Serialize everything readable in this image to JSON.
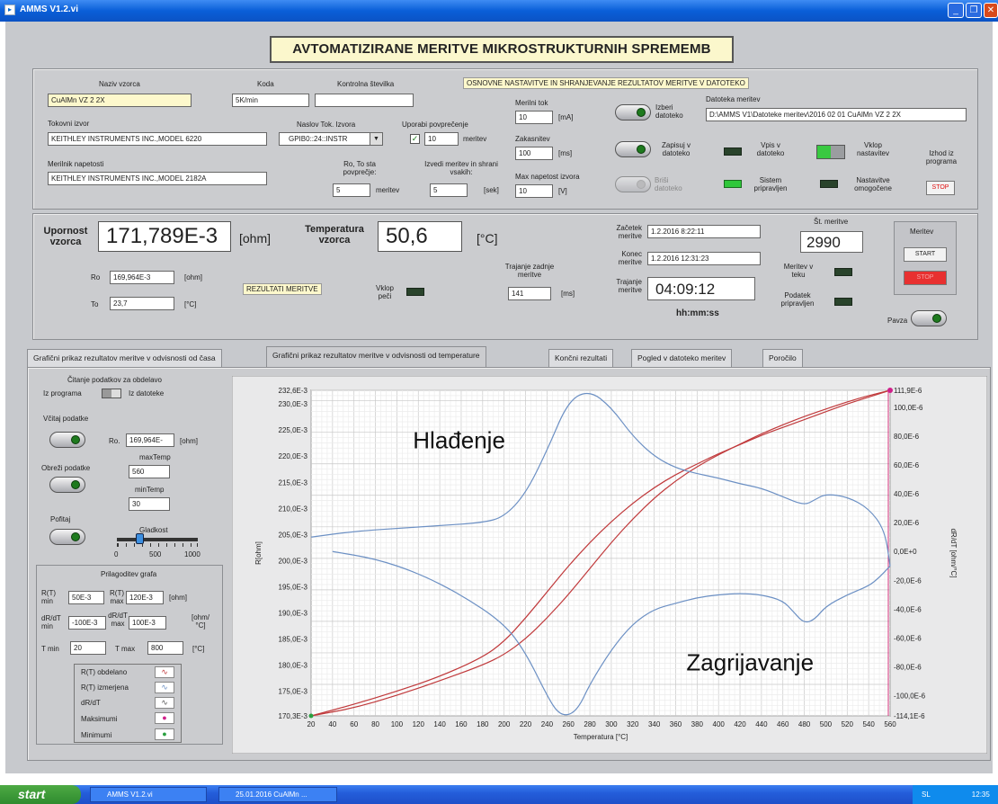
{
  "window": {
    "title": "AMMS V1.2.vi"
  },
  "header": {
    "title": "AVTOMATIZIRANE MERITVE MIKROSTRUKTURNIH SPREMEMB"
  },
  "setup": {
    "sample_name_label": "Naziv vzorca",
    "sample_name": "CuAlMn VZ 2 2X",
    "code_label": "Koda",
    "code": "5K/min",
    "checksum_label": "Kontrolna številka",
    "checksum": "",
    "section_note": "OSNOVNE NASTAVITVE IN SHRANJEVANJE REZULTATOV MERITVE V DATOTEKO",
    "current_source_label": "Tokovni izvor",
    "current_source": "KEITHLEY INSTRUMENTS INC.,MODEL 6220",
    "source_address_label": "Naslov Tok. Izvora",
    "source_address": "GPIB0::24::INSTR",
    "use_avg_label": "Uporabi povprečenje",
    "avg_count": "10",
    "avg_unit": "meritev",
    "voltmeter_label": "Merilnik napetosti",
    "voltmeter": "KEITHLEY INSTRUMENTS INC.,MODEL 2182A",
    "ro_to_label": "Ro, To sta povprečje:",
    "ro_to_value": "5",
    "ro_to_unit": "meritev",
    "save_every_label": "Izvedi meritev in shrani vsakih:",
    "save_every": "5",
    "save_every_unit": "[sek]",
    "current_label": "Merilni tok",
    "current": "10",
    "current_unit": "[mA]",
    "delay_label": "Zakasnitev",
    "delay": "100",
    "delay_unit": "[ms]",
    "max_voltage_label": "Max napetost izvora",
    "max_voltage": "10",
    "max_voltage_unit": "[V]",
    "choose_file_label": "Izberi datoteko",
    "file_label": "Datoteka meritev",
    "file_path": "D:\\AMMS V1\\Datoteke meritev\\2016 02 01 CuAlMn VZ 2 2X",
    "write_label": "Zapisuj v datoteko",
    "delete_label": "Briši datoteko",
    "write_led_label": "Vpis v datoteko",
    "system_ready_label": "Sistem pripravljen",
    "settings_input_label": "Vklop nastavitev",
    "settings_enabled_label": "Nastavitve omogočene",
    "exit_label": "Izhod iz programa",
    "exit_button": "STOP"
  },
  "results": {
    "resistance_label": "Upornost vzorca",
    "resistance": "171,789E-3",
    "resistance_unit": "[ohm]",
    "temperature_label": "Temperatura vzorca",
    "temperature": "50,6",
    "temperature_unit": "[°C]",
    "ro_label": "Ro",
    "ro": "169,964E-3",
    "ro_unit": "[ohm]",
    "to_label": "To",
    "to": "23,7",
    "to_unit": "[°C]",
    "results_note": "REZULTATI MERITVE",
    "furnace_label": "Vklop peči",
    "last_duration_label": "Trajanje zadnje meritve",
    "last_duration": "141",
    "last_duration_unit": "[ms]",
    "start_label": "Začetek meritve",
    "start": "1.2.2016   8:22:11",
    "end_label": "Konec meritve",
    "end": "1.2.2016   12:31:23",
    "duration_label": "Trajanje meritve",
    "duration": "04:09:12",
    "duration_format": "hh:mm:ss",
    "count_label": "Št. meritve",
    "count": "2990",
    "in_progress_label": "Meritev v teku",
    "data_ready_label": "Podatek pripravljen",
    "measure_label": "Meritev",
    "start_button": "START",
    "stop_button": "STOP",
    "pause_label": "Pavza"
  },
  "tabs": [
    "Grafični prikaz rezultatov  meritve v odvisnosti od časa",
    "Grafični prikaz  rezultatov meritve v odvisnosti od temperature",
    "Končni rezultati",
    "Pogled v datoteko meritev",
    "Poročilo"
  ],
  "controls": {
    "read_data_label": "Čitanje podatkov za obdelavo",
    "from_program": "Iz programa",
    "from_file": "Iz datoteke",
    "load_label": "Včitaj podatke",
    "ro_label": "Ro.",
    "ro_value": "169,964E-",
    "ro_unit": "[ohm]",
    "trim_label": "Obreži podatke",
    "max_temp_label": "maxTemp",
    "max_temp": "560",
    "min_temp_label": "minTemp",
    "min_temp": "30",
    "smooth_label": "Pofitaj",
    "smoothness_label": "Gladkost",
    "slider_ticks": [
      "0",
      "500",
      "1000"
    ],
    "smoothness": 280,
    "adjust_title": "Prilagoditev grafa",
    "rt_min_label": "R(T) min",
    "rt_min": "50E-3",
    "rt_max_label": "R(T) max",
    "rt_max": "120E-3",
    "rt_unit": "[ohm]",
    "drdt_min_label": "dR/dT min",
    "drdt_min": "-100E-3",
    "drdt_max_label": "dR/dT max",
    "drdt_max": "100E-3",
    "drdt_unit": "[ohm/°C]",
    "tmin_label": "T min",
    "tmin": "20",
    "tmax_label": "T max",
    "tmax": "800",
    "t_unit": "[°C]",
    "legend": [
      "R(T) obdelano",
      "R(T) izmerjena",
      "dR/dT",
      "Maksimumi",
      "Minimumi"
    ]
  },
  "chart_data": {
    "type": "line",
    "xlabel": "Temperatura [°C]",
    "ylabel": "R[ohm]",
    "y2label": "dR/dT [ohm/°C]",
    "xlim": [
      20,
      560
    ],
    "ylim": [
      0.1703,
      0.2326
    ],
    "y2lim": [
      -0.0001141,
      0.0001119
    ],
    "x_ticks": [
      "20",
      "40",
      "60",
      "80",
      "100",
      "120",
      "140",
      "160",
      "180",
      "200",
      "220",
      "240",
      "260",
      "280",
      "300",
      "320",
      "340",
      "360",
      "380",
      "400",
      "420",
      "440",
      "460",
      "480",
      "500",
      "520",
      "540",
      "560"
    ],
    "y_ticks": [
      "232,6E-3",
      "230,0E-3",
      "225,0E-3",
      "220,0E-3",
      "215,0E-3",
      "210,0E-3",
      "205,0E-3",
      "200,0E-3",
      "195,0E-3",
      "190,0E-3",
      "185,0E-3",
      "180,0E-3",
      "175,0E-3",
      "170,3E-3"
    ],
    "y2_ticks": [
      "111,9E-6",
      "100,0E-6",
      "80,0E-6",
      "60,0E-6",
      "40,0E-6",
      "20,0E-6",
      "0,0E+0",
      "-20,0E-6",
      "-40,0E-6",
      "-60,0E-6",
      "-80,0E-6",
      "-100,0E-6",
      "-114,1E-6"
    ],
    "annotations": [
      "Hlađenje",
      "Zagrijavanje"
    ],
    "series": [
      {
        "axis": "R",
        "color": "#c0393b",
        "x": [
          20,
          60,
          100,
          140,
          180,
          200,
          220,
          240,
          260,
          280,
          300,
          320,
          340,
          360,
          380,
          400,
          420,
          440,
          460,
          480,
          500,
          520,
          540,
          560
        ],
        "values": [
          0.1703,
          0.1725,
          0.175,
          0.1778,
          0.1815,
          0.1845,
          0.189,
          0.194,
          0.199,
          0.2035,
          0.2075,
          0.211,
          0.214,
          0.2165,
          0.2185,
          0.2205,
          0.2222,
          0.224,
          0.2255,
          0.227,
          0.2285,
          0.23,
          0.2313,
          0.2326
        ]
      },
      {
        "axis": "R",
        "color": "#c0393b",
        "x": [
          20,
          60,
          100,
          140,
          180,
          200,
          220,
          240,
          260,
          280,
          300,
          320,
          340,
          360,
          380,
          400,
          420,
          440,
          460,
          480,
          500,
          520,
          540,
          560
        ],
        "values": [
          0.1703,
          0.1718,
          0.1742,
          0.177,
          0.18,
          0.182,
          0.185,
          0.189,
          0.1935,
          0.1985,
          0.2035,
          0.208,
          0.212,
          0.2153,
          0.218,
          0.2203,
          0.2223,
          0.2243,
          0.226,
          0.2276,
          0.229,
          0.2304,
          0.2316,
          0.2326
        ]
      },
      {
        "axis": "dRdT",
        "color": "#6c90c4",
        "x": [
          20,
          60,
          100,
          140,
          180,
          200,
          220,
          240,
          260,
          280,
          300,
          320,
          340,
          360,
          380,
          400,
          420,
          440,
          460,
          480,
          490,
          500,
          520,
          540,
          555,
          560
        ],
        "values": [
          1e-05,
          1.4e-05,
          1.6e-05,
          1.8e-05,
          2e-05,
          2.4e-05,
          4e-05,
          7e-05,
          0.000105,
          0.0001119,
          0.0001,
          8e-05,
          6.6e-05,
          5.8e-05,
          5.4e-05,
          5.1e-05,
          4.7e-05,
          4.4e-05,
          3.8e-05,
          3.2e-05,
          3.6e-05,
          4e-05,
          3.8e-05,
          3e-05,
          1.5e-05,
          -1e-05
        ]
      },
      {
        "axis": "dRdT",
        "color": "#6c90c4",
        "x": [
          40,
          80,
          120,
          160,
          200,
          220,
          240,
          250,
          260,
          270,
          280,
          300,
          320,
          340,
          360,
          380,
          400,
          420,
          440,
          460,
          470,
          480,
          490,
          500,
          520,
          540,
          550,
          560
        ],
        "values": [
          0,
          -5e-06,
          -1.5e-05,
          -3e-05,
          -5e-05,
          -7e-05,
          -0.0001,
          -0.000112,
          -0.0001141,
          -0.000108,
          -9.2e-05,
          -6.8e-05,
          -5e-05,
          -4e-05,
          -3.6e-05,
          -3.2e-05,
          -3e-05,
          -2.9e-05,
          -3e-05,
          -3.4e-05,
          -4.2e-05,
          -5e-05,
          -4.7e-05,
          -3.8e-05,
          -3e-05,
          -2.4e-05,
          -1.8e-05,
          -1e-05
        ]
      }
    ]
  },
  "taskbar": {
    "start": "start",
    "items": [
      "AMMS V1.2.vi",
      "25.01.2016 CuAlMn ..."
    ],
    "tray": "SL",
    "clock": "12:35"
  }
}
